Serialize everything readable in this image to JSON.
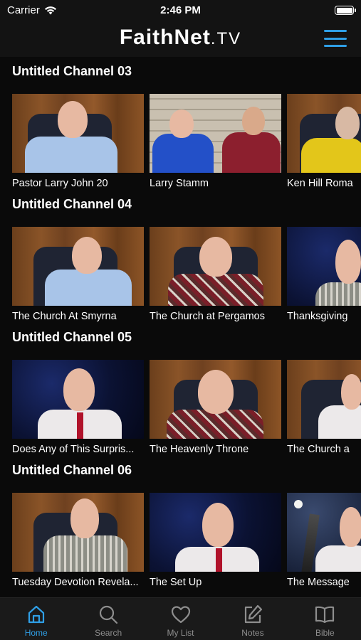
{
  "status_bar": {
    "carrier": "Carrier",
    "time": "2:46 PM"
  },
  "header": {
    "logo_main": "FaithNet",
    "logo_suffix": ".TV"
  },
  "colors": {
    "accent": "#2f9fe6",
    "background": "#0a0a0a",
    "bar": "#131313"
  },
  "channels": [
    {
      "title": "Untitled Channel 03",
      "videos": [
        {
          "label": "Pastor Larry John 20"
        },
        {
          "label": "Larry Stamm"
        },
        {
          "label": "Ken Hill Roma"
        }
      ]
    },
    {
      "title": "Untitled Channel 04",
      "videos": [
        {
          "label": "The Church At Smyrna"
        },
        {
          "label": "The Church at Pergamos"
        },
        {
          "label": "Thanksgiving"
        }
      ]
    },
    {
      "title": "Untitled Channel 05",
      "videos": [
        {
          "label": "Does Any of This Surpris..."
        },
        {
          "label": "The Heavenly Throne"
        },
        {
          "label": "The Church a"
        }
      ]
    },
    {
      "title": "Untitled Channel 06",
      "videos": [
        {
          "label": "Tuesday Devotion Revela..."
        },
        {
          "label": "The Set Up"
        },
        {
          "label": "The Message"
        }
      ]
    }
  ],
  "tabs": [
    {
      "label": "Home",
      "icon": "home-icon",
      "active": true
    },
    {
      "label": "Search",
      "icon": "search-icon"
    },
    {
      "label": "My List",
      "icon": "heart-icon"
    },
    {
      "label": "Notes",
      "icon": "notes-icon"
    },
    {
      "label": "Bible",
      "icon": "book-icon"
    }
  ]
}
